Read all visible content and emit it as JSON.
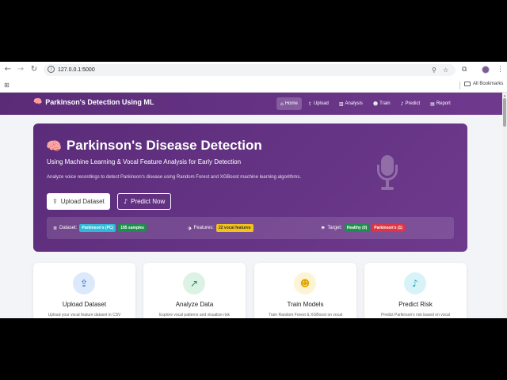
{
  "browser": {
    "url": "127.0.0.1:5000",
    "bookmarks_label": "All Bookmarks"
  },
  "navbar": {
    "brand": "Parkinson's Detection Using ML",
    "links": [
      {
        "label": "Home",
        "icon": "home-icon",
        "active": true
      },
      {
        "label": "Upload",
        "icon": "upload-icon"
      },
      {
        "label": "Analysis",
        "icon": "chart-icon"
      },
      {
        "label": "Train",
        "icon": "robot-icon"
      },
      {
        "label": "Predict",
        "icon": "mic-icon"
      },
      {
        "label": "Report",
        "icon": "document-icon"
      }
    ]
  },
  "hero": {
    "title": "Parkinson's Disease Detection",
    "subtitle": "Using Machine Learning & Vocal Feature Analysis for Early Detection",
    "description": "Analyze voice recordings to detect Parkinson's disease using Random Forest and XGBoost machine learning algorithms.",
    "upload_button": "Upload Dataset",
    "predict_button": "Predict Now",
    "dataset_label": "Dataset:",
    "dataset_name": "Parkinson's (PC)",
    "samples": "195 samples",
    "features_label": "Features:",
    "features_value": "22 vocal features",
    "target_label": "Target:",
    "target_healthy": "Healthy (0)",
    "target_parkinsons": "Parkinson's (1)"
  },
  "cards": [
    {
      "title": "Upload Dataset",
      "desc": "Upload your vocal feature dataset in CSV",
      "icon": "upload-icon",
      "color": "#1f6fd1",
      "bg": "#dce9fb"
    },
    {
      "title": "Analyze Data",
      "desc": "Explore vocal patterns and visualize risk",
      "icon": "line-chart-icon",
      "color": "#1e8e4e",
      "bg": "#dcf2e5"
    },
    {
      "title": "Train Models",
      "desc": "Train Random Forest & XGBoost on vocal",
      "icon": "robot-icon",
      "color": "#e0a800",
      "bg": "#fdf4d6"
    },
    {
      "title": "Predict Risk",
      "desc": "Predict Parkinson's risk based on vocal",
      "icon": "mic-icon",
      "color": "#1aa8c6",
      "bg": "#d8f3f8"
    }
  ],
  "colors": {
    "nav_gradient_start": "#5b2b78",
    "hero_bg": "#5b2c7a",
    "page_bg": "#f3f4f8"
  }
}
